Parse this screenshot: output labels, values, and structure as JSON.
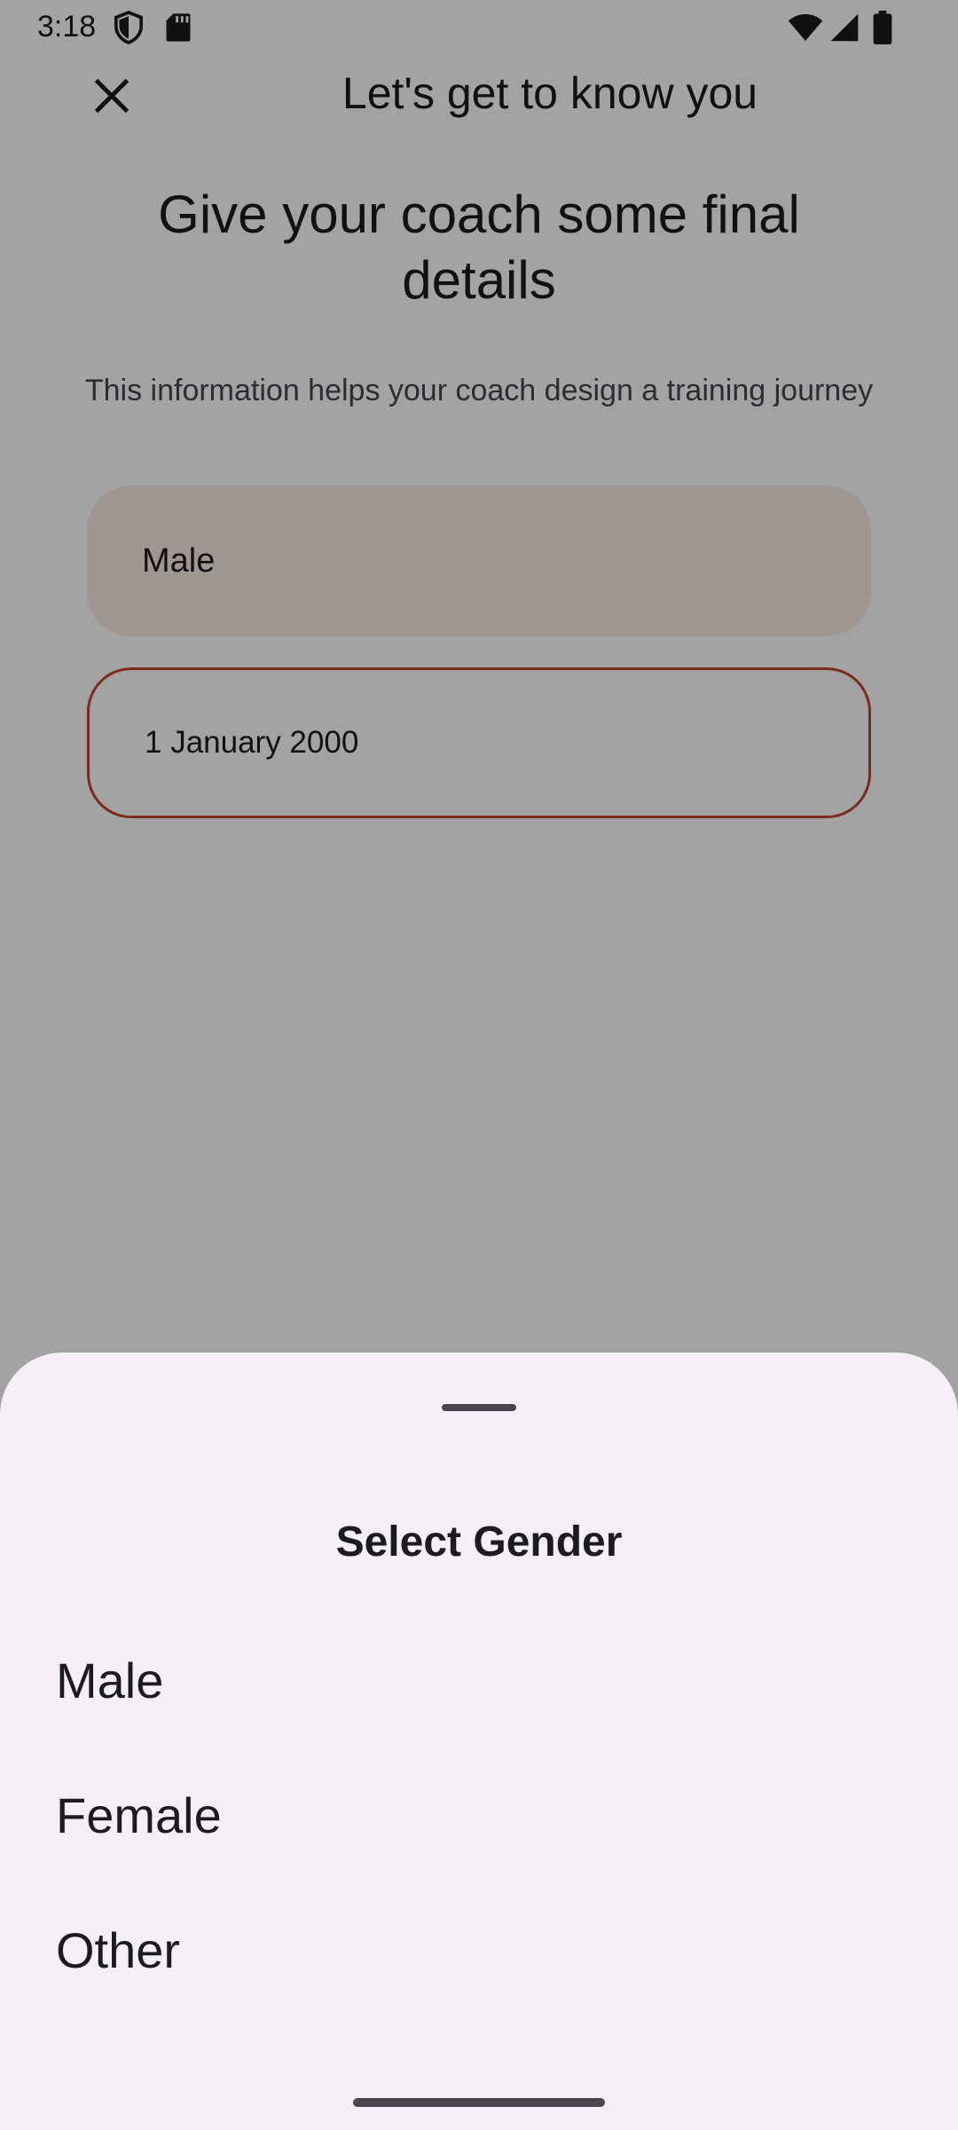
{
  "status_bar": {
    "time": "3:18",
    "icons": [
      "shield-icon",
      "sd-card-icon",
      "wifi-icon",
      "signal-icon",
      "battery-icon"
    ]
  },
  "app_bar": {
    "title": "Let's get to know you",
    "close_icon": "close-icon"
  },
  "content": {
    "headline": "Give your coach some final details",
    "subtitle": "This information helps your coach design a training journey",
    "gender_field_value": "Male",
    "dob_field_value": "1 January 2000"
  },
  "sheet": {
    "title": "Select Gender",
    "options": [
      {
        "label": "Male"
      },
      {
        "label": "Female"
      },
      {
        "label": "Other"
      }
    ]
  },
  "colors": {
    "accent_error": "#c4442f",
    "selected_field_bg": "#f9ebe5",
    "sheet_bg": "#f4f0f6",
    "text_primary": "#1c1b1f"
  }
}
